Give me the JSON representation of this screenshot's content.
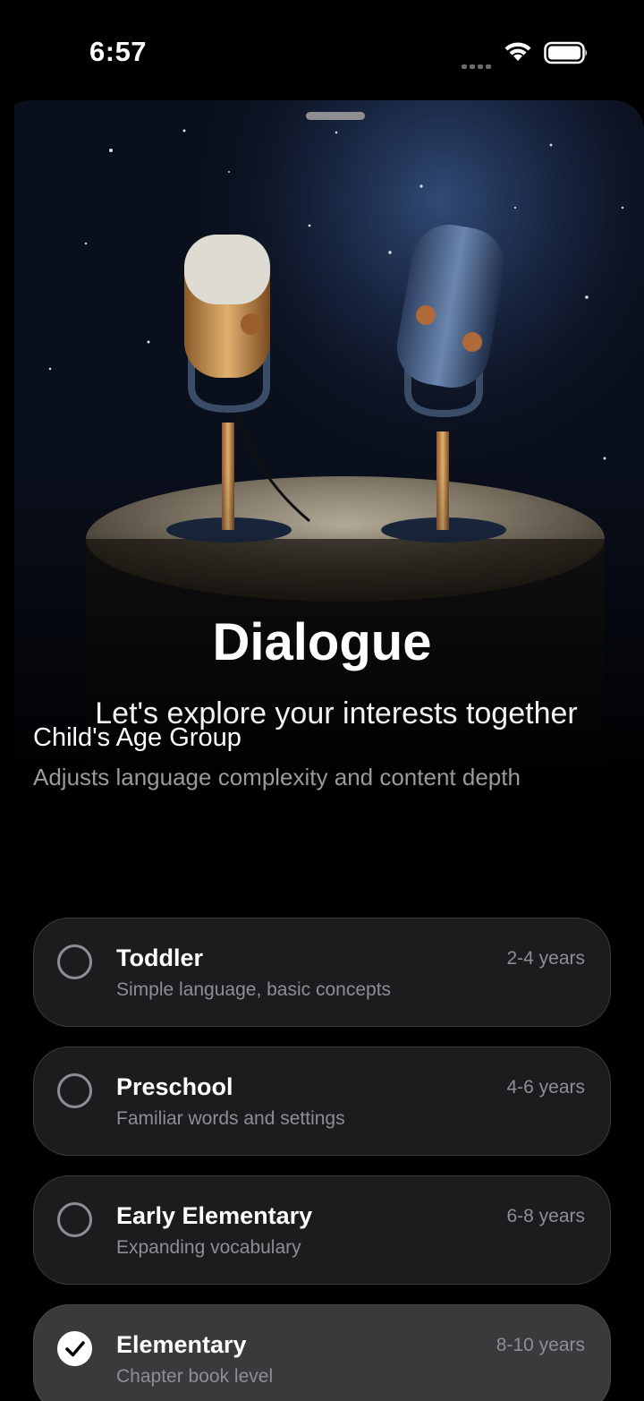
{
  "status_bar": {
    "time": "6:57",
    "icons": [
      "signal-dots-icon",
      "wifi-icon",
      "battery-icon"
    ]
  },
  "hero": {
    "title": "Dialogue",
    "subtitle": "Let's explore your interests together",
    "image": "two-microphones-illustration"
  },
  "age_group": {
    "title": "Child's Age Group",
    "subtitle": "Adjusts language complexity and content depth",
    "options": [
      {
        "name": "Toddler",
        "description": "Simple language, basic concepts",
        "range": "2-4 years",
        "selected": false
      },
      {
        "name": "Preschool",
        "description": "Familiar words and settings",
        "range": "4-6 years",
        "selected": false
      },
      {
        "name": "Early Elementary",
        "description": "Expanding vocabulary",
        "range": "6-8 years",
        "selected": false
      },
      {
        "name": "Elementary",
        "description": "Chapter book level",
        "range": "8-10 years",
        "selected": true
      }
    ]
  },
  "colors": {
    "background": "#000000",
    "card": "#1c1c1e",
    "card_selected": "#3a3a3c",
    "secondary_text": "#8e8e93"
  }
}
